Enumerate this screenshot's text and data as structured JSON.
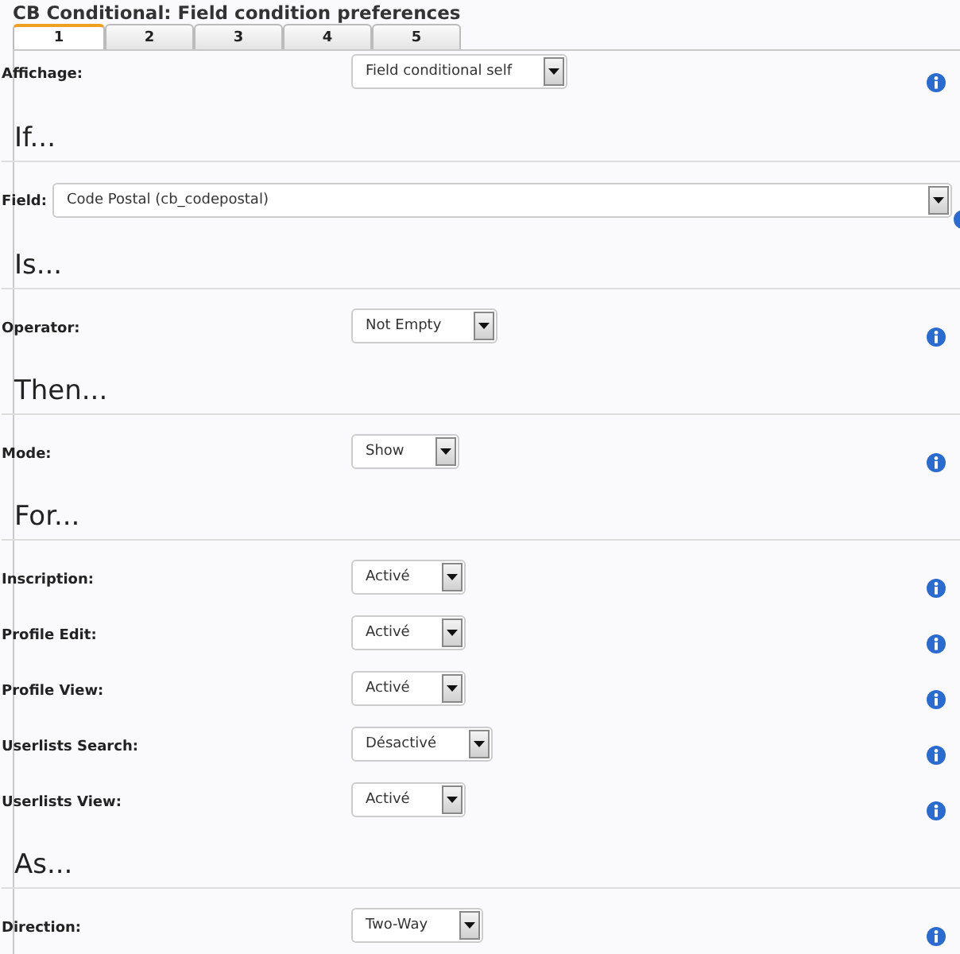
{
  "title": "CB Conditional: Field condition preferences",
  "tabs": [
    {
      "label": "1",
      "selected": true
    },
    {
      "label": "2",
      "selected": false
    },
    {
      "label": "3",
      "selected": false
    },
    {
      "label": "4",
      "selected": false
    },
    {
      "label": "5",
      "selected": false
    }
  ],
  "sections": [
    {
      "rows": [
        {
          "label": "Affichage:",
          "value": "Field conditional self",
          "kind": "normal"
        }
      ]
    },
    {
      "heading": "If...",
      "rows": [
        {
          "label": "Field:",
          "value": "Code Postal (cb_codepostal)",
          "kind": "wide"
        }
      ]
    },
    {
      "heading": "Is...",
      "rows": [
        {
          "label": "Operator:",
          "value": "Not Empty",
          "kind": "normal"
        }
      ]
    },
    {
      "heading": "Then...",
      "rows": [
        {
          "label": "Mode:",
          "value": "Show",
          "kind": "normal"
        }
      ]
    },
    {
      "heading": "For...",
      "rows": [
        {
          "label": "Inscription:",
          "value": "Activé",
          "kind": "normal"
        },
        {
          "label": "Profile Edit:",
          "value": "Activé",
          "kind": "normal"
        },
        {
          "label": "Profile View:",
          "value": "Activé",
          "kind": "normal"
        },
        {
          "label": "Userlists Search:",
          "value": "Désactivé",
          "kind": "normal"
        },
        {
          "label": "Userlists View:",
          "value": "Activé",
          "kind": "normal"
        }
      ]
    },
    {
      "heading": "As...",
      "rows": [
        {
          "label": "Direction:",
          "value": "Two-Way",
          "kind": "normal"
        }
      ]
    }
  ]
}
